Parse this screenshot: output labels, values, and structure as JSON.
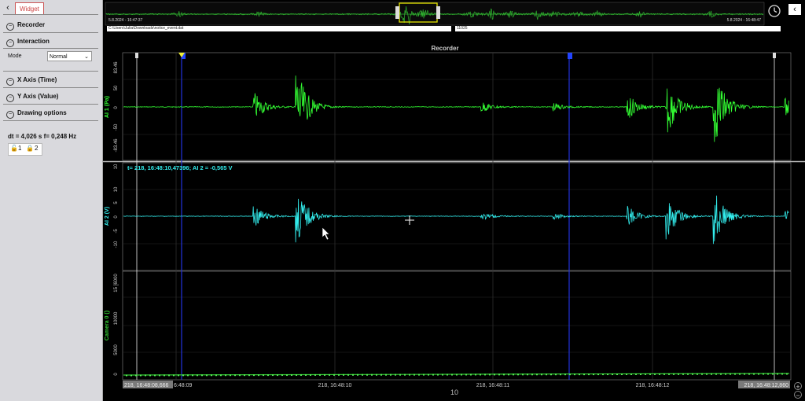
{
  "sidebar": {
    "back_icon": "chevron-left-icon",
    "tab_label": "Widget",
    "sections": [
      {
        "label": "Recorder"
      },
      {
        "label": "Interaction"
      },
      {
        "label": "X Axis (Time)"
      },
      {
        "label": "Y Axis (Value)"
      },
      {
        "label": "Drawing options"
      }
    ],
    "mode_label": "Mode",
    "mode_value": "Normal",
    "dt_text": "dt = 4,026 s  f= 0,248 Hz",
    "locks": [
      "1",
      "2"
    ]
  },
  "overview": {
    "start_time": "5.8.2024 - 16:47:37",
    "end_time": "5.8.2024 - 16:48:47",
    "path": "C:\\Users\\Julia\\Downloads\\notice_event.dat",
    "count": "11025"
  },
  "recorder": {
    "title": "Recorder",
    "cursor_readout": "t= 218, 16:48:10,47396; AI 2 = -0,565 V",
    "charts": [
      {
        "ylabel": "AI 1 (Pa)",
        "top_label": "83.46",
        "mid_label": "0",
        "bottom_label": "-83.46",
        "ticks": [
          "50",
          "0",
          "-50"
        ],
        "color": "#33ff33"
      },
      {
        "ylabel": "AI 2 (V)",
        "top_label": "10",
        "mid_label": "0",
        "bottom_label": "-10",
        "ticks": [
          "10",
          "5",
          "0",
          "-5",
          "-10"
        ],
        "color": "#33eeee"
      },
      {
        "ylabel": "Camera 0 ()",
        "top_label": "15 [6000",
        "ticks": [
          "10000",
          "5000",
          "0"
        ],
        "color": "#33cc33"
      }
    ],
    "x_ticks": [
      "218, 16:48:08,666",
      "6:48:09",
      "218, 16:48:10",
      "218, 16:48:11",
      "218, 16:48:12",
      "218, 16:48:12,860"
    ],
    "x_unit": "10"
  }
}
